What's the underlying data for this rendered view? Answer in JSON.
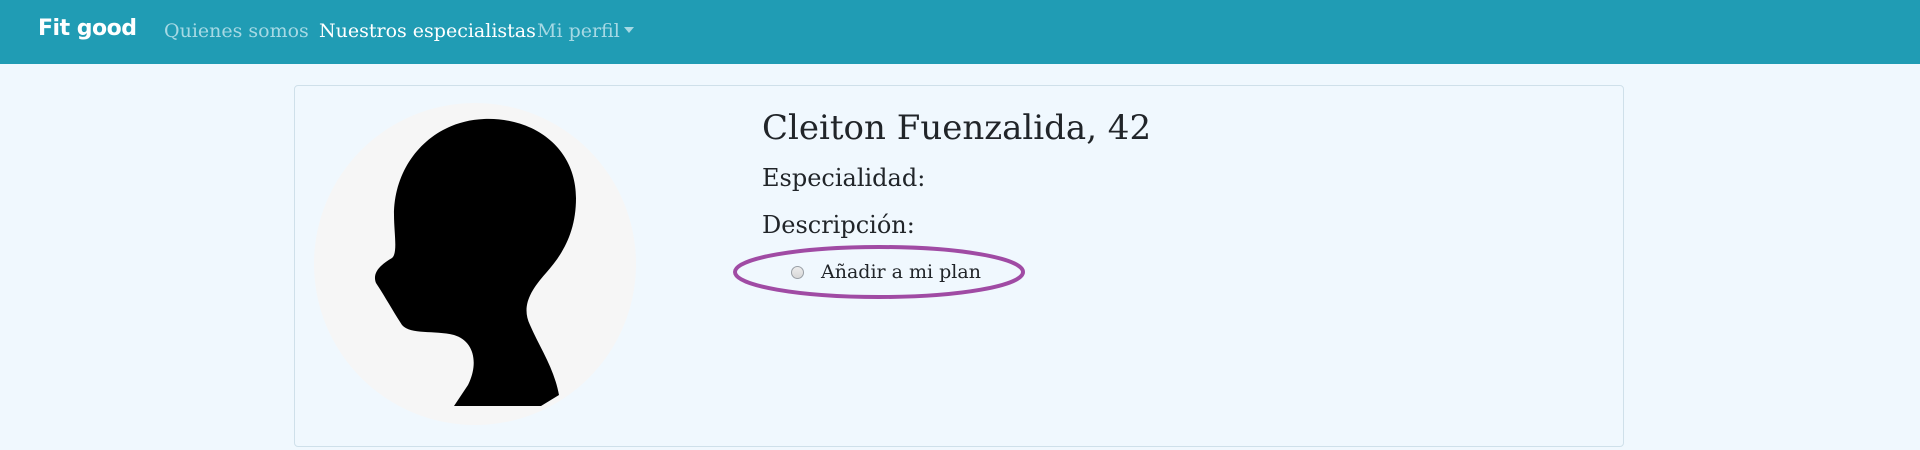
{
  "navbar": {
    "brand": "Fit good",
    "links": {
      "about": "Quienes somos",
      "specialists": "Nuestros especialistas",
      "profile": "Mi perfil"
    },
    "background_color": "#209cb4",
    "active_link_color": "#ffffff",
    "inactive_link_color": "#a6d9e4"
  },
  "profile": {
    "name_age": "Cleiton Fuenzalida, 42",
    "specialty_label": "Especialidad:",
    "description_label": "Descripción:",
    "add_to_plan_label": "Añadir a mi plan",
    "add_to_plan_checked": false,
    "avatar_icon": "person-silhouette-icon"
  },
  "annotation": {
    "color": "#a04ba4",
    "shape": "ellipse"
  }
}
